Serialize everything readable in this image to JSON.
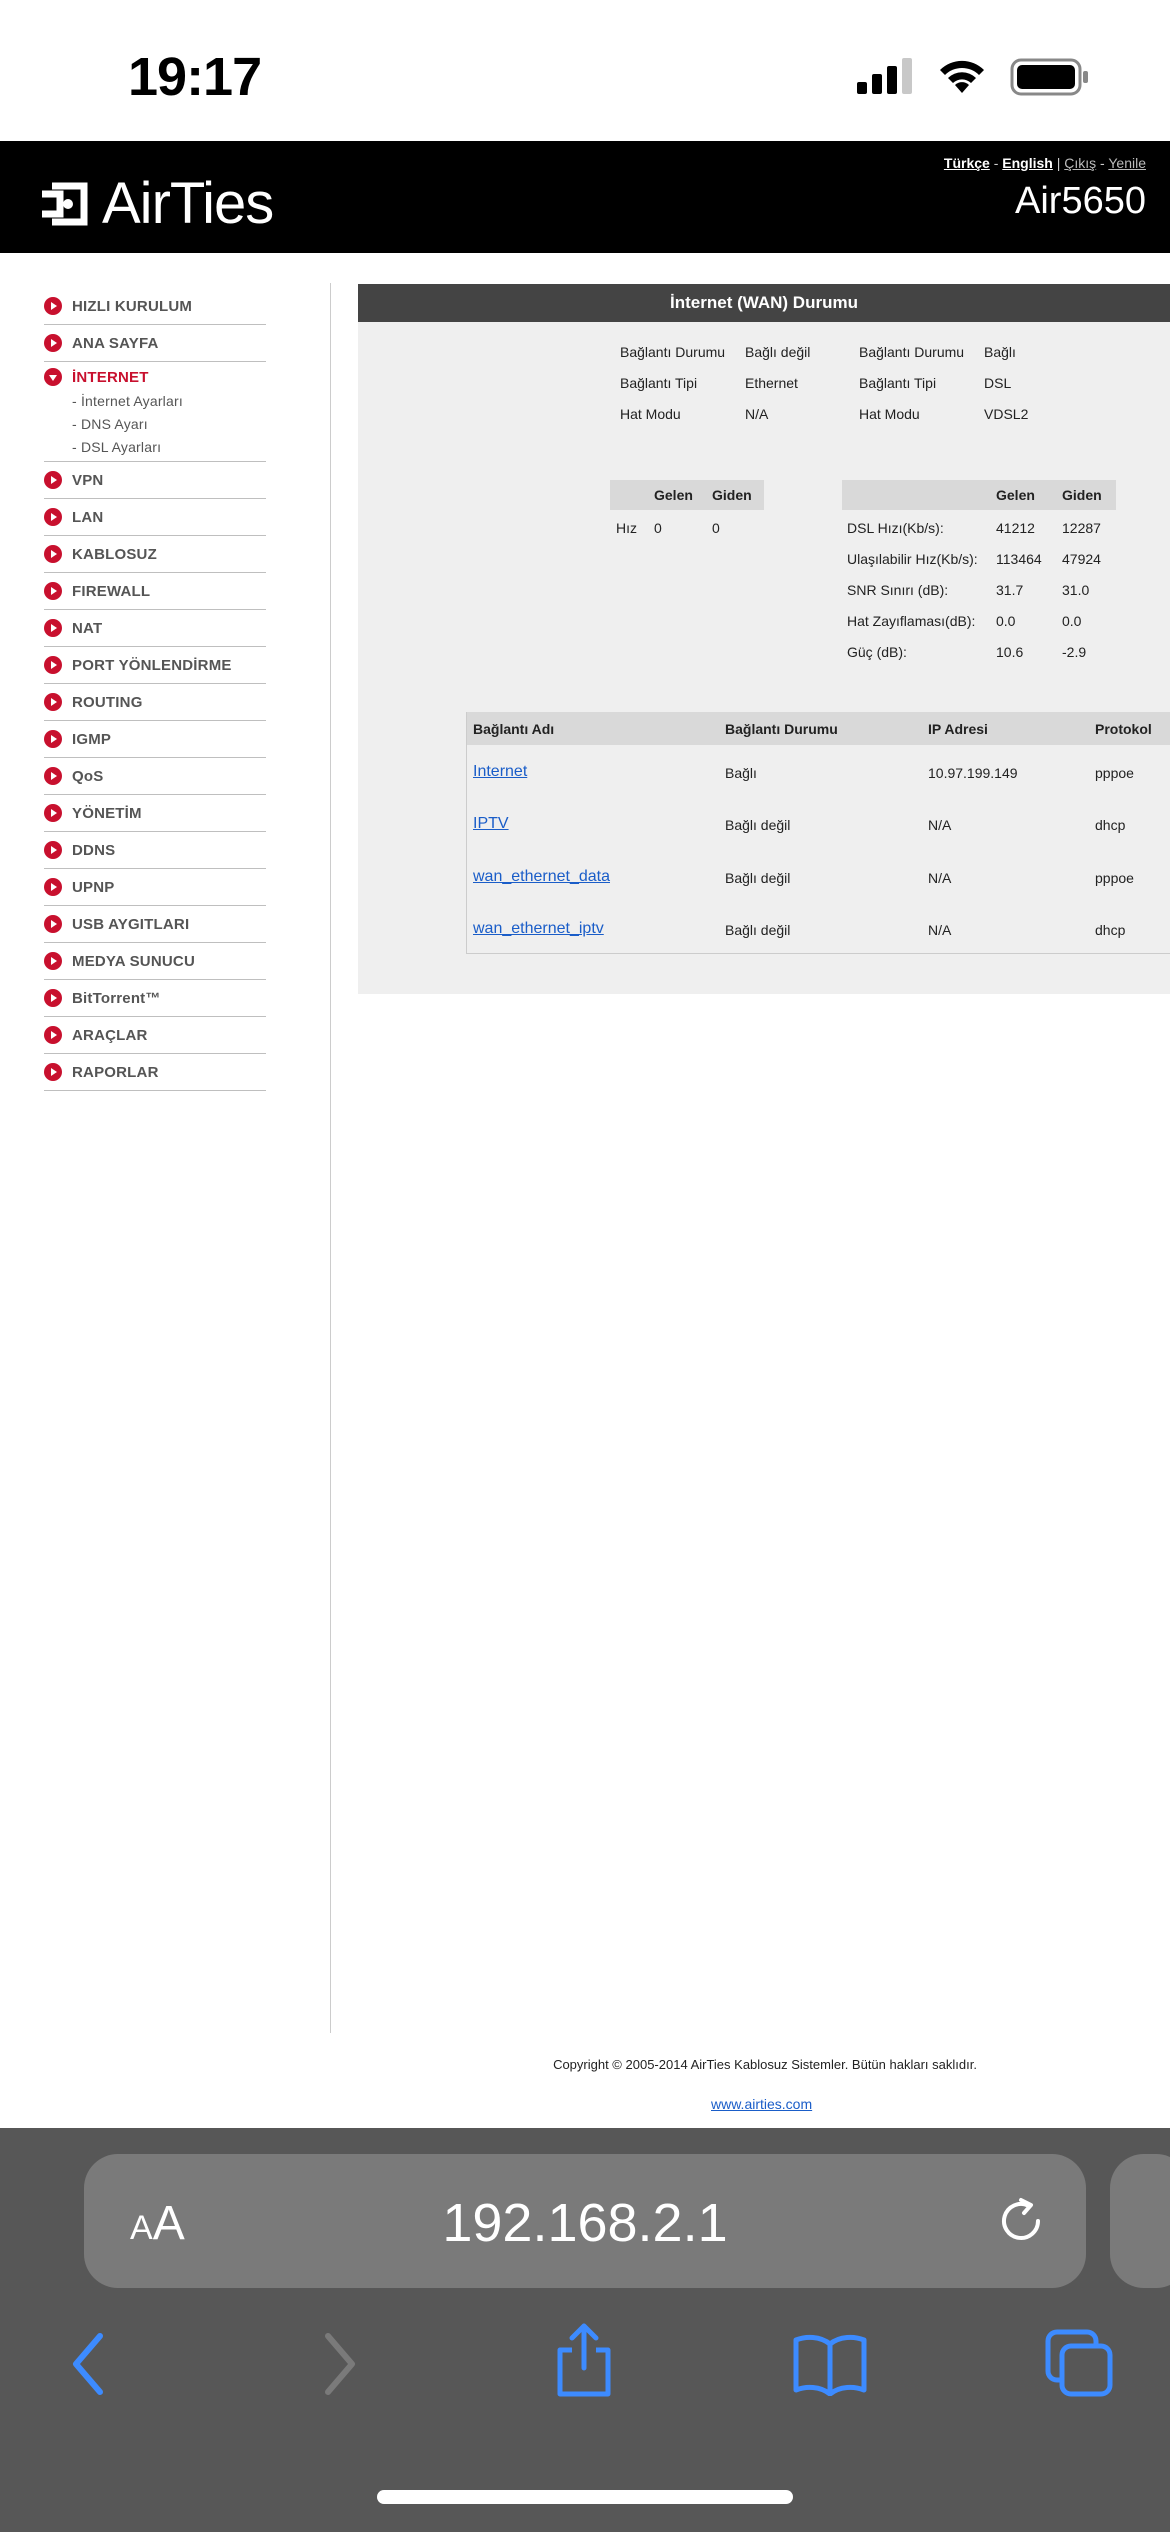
{
  "status": {
    "time": "19:17"
  },
  "header": {
    "brand": "AirTies",
    "model": "Air5650",
    "lang_tr": "Türkçe",
    "lang_en": "English",
    "logout": "Çıkış",
    "refresh": "Yenile",
    "dash": "-",
    "pipe": "|"
  },
  "sidebar": {
    "items": [
      {
        "label": "HIZLI KURULUM"
      },
      {
        "label": "ANA SAYFA"
      },
      {
        "label": "İNTERNET",
        "open": true,
        "sub": [
          "- İnternet Ayarları",
          "- DNS Ayarı",
          "- DSL Ayarları"
        ]
      },
      {
        "label": "VPN"
      },
      {
        "label": "LAN"
      },
      {
        "label": "KABLOSUZ"
      },
      {
        "label": "FIREWALL"
      },
      {
        "label": "NAT"
      },
      {
        "label": "PORT YÖNLENDİRME"
      },
      {
        "label": "ROUTING"
      },
      {
        "label": "IGMP"
      },
      {
        "label": "QoS"
      },
      {
        "label": "YÖNETİM"
      },
      {
        "label": "DDNS"
      },
      {
        "label": "UPNP"
      },
      {
        "label": "USB AYGITLARI"
      },
      {
        "label": "MEDYA SUNUCU"
      },
      {
        "label": "BitTorrent™"
      },
      {
        "label": "ARAÇLAR"
      },
      {
        "label": "RAPORLAR"
      }
    ]
  },
  "panel": {
    "title": "İnternet (WAN) Durumu",
    "left_status": {
      "labels": [
        "Bağlantı Durumu",
        "Bağlantı Tipi",
        "Hat Modu"
      ],
      "values": [
        "Bağlı değil",
        "Ethernet",
        "N/A"
      ]
    },
    "right_status": {
      "labels": [
        "Bağlantı Durumu",
        "Bağlantı Tipi",
        "Hat Modu"
      ],
      "values": [
        "Bağlı",
        "DSL",
        "VDSL2"
      ]
    },
    "speed": {
      "col_in": "Gelen",
      "col_out": "Giden",
      "row_label": "Hız",
      "in": "0",
      "out": "0"
    },
    "dsl": {
      "col_in": "Gelen",
      "col_out": "Giden",
      "rows": [
        {
          "label": "DSL Hızı(Kb/s):",
          "in": "41212",
          "out": "12287"
        },
        {
          "label": "Ulaşılabilir Hız(Kb/s):",
          "in": "113464",
          "out": "47924"
        },
        {
          "label": "SNR Sınırı (dB):",
          "in": "31.7",
          "out": "31.0"
        },
        {
          "label": "Hat Zayıflaması(dB):",
          "in": "0.0",
          "out": "0.0"
        },
        {
          "label": "Güç (dB):",
          "in": "10.6",
          "out": "-2.9"
        }
      ]
    },
    "connections": {
      "headers": [
        "Bağlantı Adı",
        "Bağlantı Durumu",
        "IP Adresi",
        "Protokol"
      ],
      "rows": [
        {
          "name": "Internet",
          "status": "Bağlı",
          "ip": "10.97.199.149",
          "proto": "pppoe"
        },
        {
          "name": "IPTV",
          "status": "Bağlı değil",
          "ip": "N/A",
          "proto": "dhcp"
        },
        {
          "name": "wan_ethernet_data",
          "status": "Bağlı değil",
          "ip": "N/A",
          "proto": "pppoe"
        },
        {
          "name": "wan_ethernet_iptv",
          "status": "Bağlı değil",
          "ip": "N/A",
          "proto": "dhcp"
        }
      ]
    }
  },
  "footer": {
    "copyright": "Copyright © 2005-2014 AirTies Kablosuz Sistemler. Bütün hakları saklıdır.",
    "site": "www.airties.com"
  },
  "safari": {
    "aa_small": "A",
    "aa_big": "A",
    "url": "192.168.2.1"
  }
}
